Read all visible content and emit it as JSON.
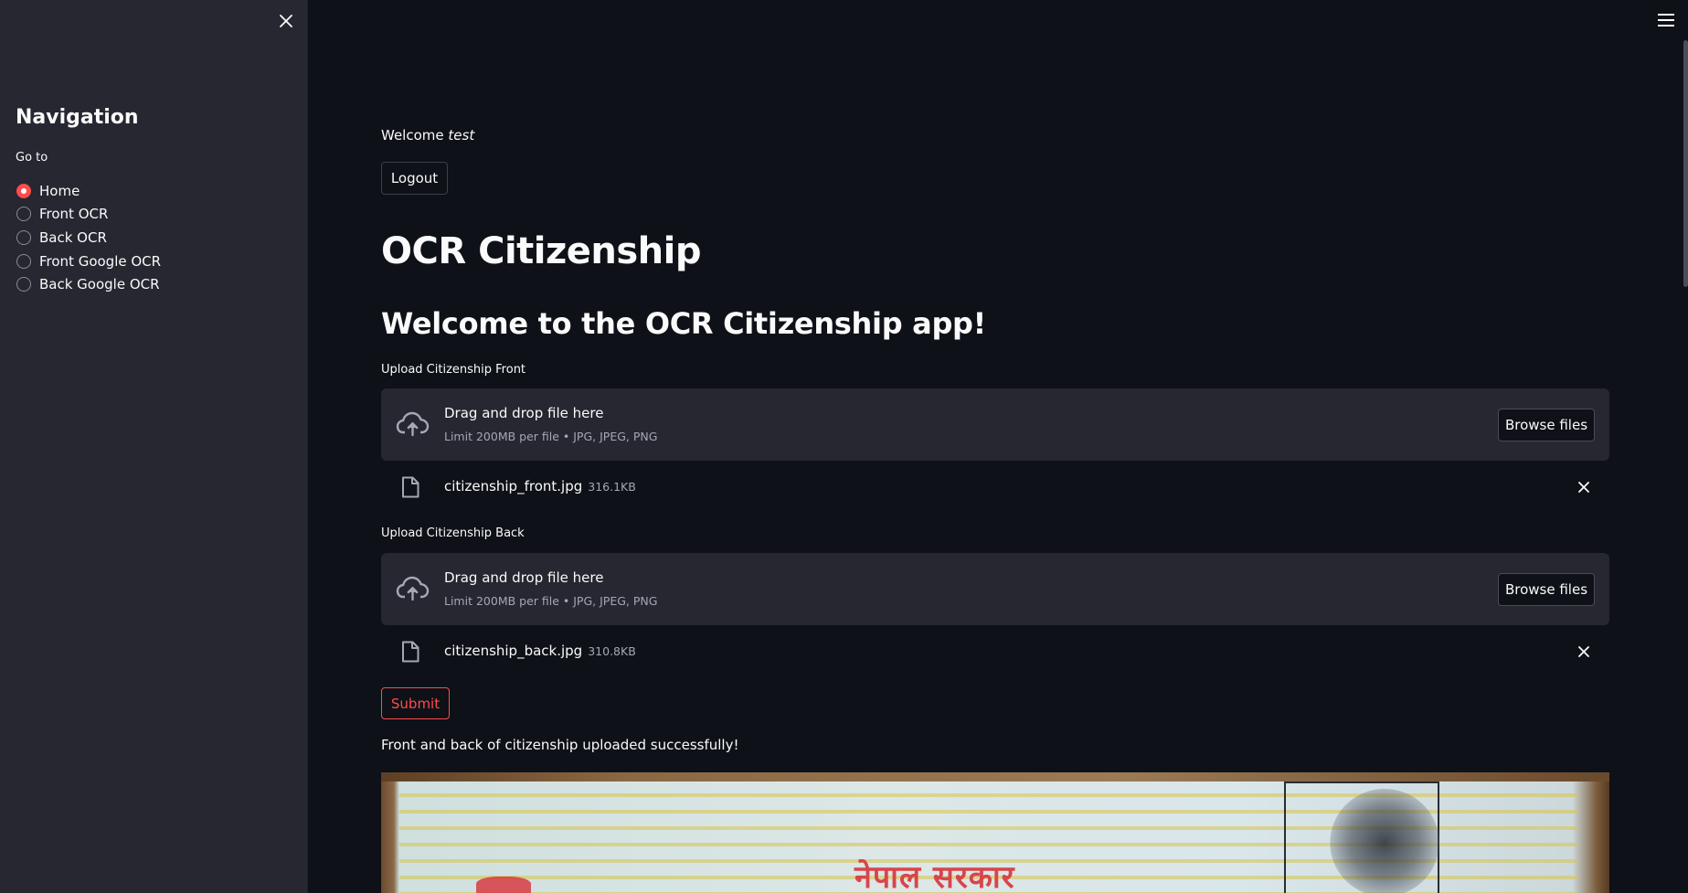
{
  "sidebar": {
    "title": "Navigation",
    "radio_label": "Go to",
    "items": [
      {
        "label": "Home",
        "selected": true
      },
      {
        "label": "Front OCR",
        "selected": false
      },
      {
        "label": "Back OCR",
        "selected": false
      },
      {
        "label": "Front Google OCR",
        "selected": false
      },
      {
        "label": "Back Google OCR",
        "selected": false
      }
    ]
  },
  "main": {
    "welcome_prefix": "Welcome ",
    "welcome_user": "test",
    "logout_label": "Logout",
    "title": "OCR Citizenship",
    "subtitle": "Welcome to the OCR Citizenship app!",
    "front_upload": {
      "label": "Upload Citizenship Front",
      "dropzone_title": "Drag and drop file here",
      "dropzone_limit": "Limit 200MB per file • JPG, JPEG, PNG",
      "browse_label": "Browse files",
      "file_name": "citizenship_front.jpg",
      "file_size": "316.1KB"
    },
    "back_upload": {
      "label": "Upload Citizenship Back",
      "dropzone_title": "Drag and drop file here",
      "dropzone_limit": "Limit 200MB per file • JPG, JPEG, PNG",
      "browse_label": "Browse files",
      "file_name": "citizenship_back.jpg",
      "file_size": "310.8KB"
    },
    "submit_label": "Submit",
    "success_message": "Front and back of citizenship uploaded successfully!",
    "image_heading": "नेपाल सरकार"
  },
  "colors": {
    "background": "#0e1117",
    "sidebar": "#262730",
    "accent": "#ff4b4b",
    "text": "#fafafa",
    "muted_text": "#a3a8b4"
  },
  "icons": {
    "sidebar_close": "close-icon",
    "menu": "hamburger-menu-icon",
    "upload": "cloud-upload-icon",
    "file": "file-icon",
    "remove": "close-icon"
  }
}
